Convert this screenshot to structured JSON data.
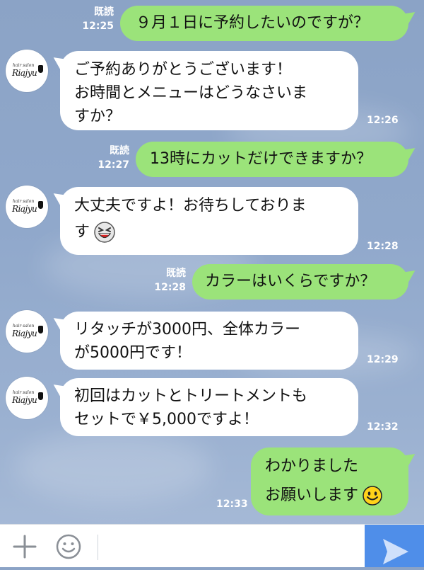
{
  "messages": [
    {
      "side": "out",
      "text": "９月１日に予約したいのですが？",
      "read": "既読",
      "time": "12:25"
    },
    {
      "side": "in",
      "lines": [
        "ご予約ありがとうございます！",
        "お時間とメニューはどうなさいま",
        "すか？"
      ],
      "time": "12:26"
    },
    {
      "side": "out",
      "text": "13時にカットだけできますか？",
      "read": "既読",
      "time": "12:27"
    },
    {
      "side": "in",
      "lines": [
        "大丈夫ですよ！お待ちしておりま",
        "す"
      ],
      "emoji": "laughing-emoji",
      "time": "12:28"
    },
    {
      "side": "out",
      "text": "カラーはいくらですか？",
      "read": "既読",
      "time": "12:28"
    },
    {
      "side": "in",
      "lines": [
        "リタッチが3000円、全体カラー",
        "が5000円です！"
      ],
      "time": "12:29"
    },
    {
      "side": "in",
      "lines": [
        "初回はカットとトリートメントも",
        "セットで￥5,000ですよ！"
      ],
      "time": "12:32"
    },
    {
      "side": "out",
      "lines": [
        "わかりました",
        "お願いします"
      ],
      "emoji": "smiling-emoji",
      "time": "12:33"
    }
  ],
  "avatar": {
    "logo_small": "hair salon",
    "logo_main": "Riajyu"
  },
  "input_bar": {
    "plus_icon": "plus-icon",
    "emoji_icon": "smiley-icon",
    "send_icon": "send-arrow-icon"
  },
  "colors": {
    "outgoing": "#9be37a",
    "incoming": "#ffffff",
    "send": "#4f8ee9"
  }
}
